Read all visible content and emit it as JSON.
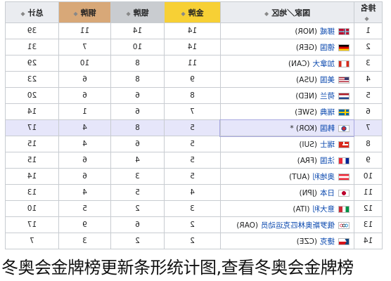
{
  "colors": {
    "header_gold": "#f7d035",
    "header_silver": "#c9ccd0",
    "header_bronze": "#d8a878",
    "header_default": "#eaecf0",
    "host_row": "#e6e6fa",
    "link": "#0645ad"
  },
  "table": {
    "headers": {
      "rank": "排名",
      "nation": "国家／地区",
      "gold": "金牌",
      "silver": "银牌",
      "bronze": "铜牌",
      "total": "总计"
    },
    "rows": [
      {
        "rank": "1",
        "flag": "flag-norway-icon",
        "name": "挪威",
        "code": "(NOR)",
        "gold": "14",
        "silver": "14",
        "bronze": "11",
        "total": "39"
      },
      {
        "rank": "2",
        "flag": "flag-germany-icon",
        "name": "德国",
        "code": "(GER)",
        "gold": "14",
        "silver": "10",
        "bronze": "7",
        "total": "31"
      },
      {
        "rank": "3",
        "flag": "flag-canada-icon",
        "name": "加拿大",
        "code": "(CAN)",
        "gold": "11",
        "silver": "8",
        "bronze": "10",
        "total": "29"
      },
      {
        "rank": "4",
        "flag": "flag-usa-icon",
        "name": "美国",
        "code": "(USA)",
        "gold": "9",
        "silver": "8",
        "bronze": "6",
        "total": "23"
      },
      {
        "rank": "5",
        "flag": "flag-netherlands-icon",
        "name": "荷兰",
        "code": "(NED)",
        "gold": "8",
        "silver": "6",
        "bronze": "6",
        "total": "20"
      },
      {
        "rank": "6",
        "flag": "flag-sweden-icon",
        "name": "瑞典",
        "code": "(SWE)",
        "gold": "7",
        "silver": "6",
        "bronze": "1",
        "total": "14"
      },
      {
        "rank": "7",
        "flag": "flag-korea-icon",
        "name": "韩国",
        "code": "(KOR) *",
        "gold": "5",
        "silver": "8",
        "bronze": "4",
        "total": "17",
        "host": true
      },
      {
        "rank": "8",
        "flag": "flag-switzerland-icon",
        "name": "瑞士",
        "code": "(SUI)",
        "gold": "5",
        "silver": "6",
        "bronze": "4",
        "total": "15"
      },
      {
        "rank": "9",
        "flag": "flag-france-icon",
        "name": "法国",
        "code": "(FRA)",
        "gold": "5",
        "silver": "4",
        "bronze": "6",
        "total": "15"
      },
      {
        "rank": "10",
        "flag": "flag-austria-icon",
        "name": "奥地利",
        "code": "(AUT)",
        "gold": "5",
        "silver": "3",
        "bronze": "6",
        "total": "14"
      },
      {
        "rank": "11",
        "flag": "flag-japan-icon",
        "name": "日本",
        "code": "(JPN)",
        "gold": "4",
        "silver": "5",
        "bronze": "4",
        "total": "13"
      },
      {
        "rank": "12",
        "flag": "flag-italy-icon",
        "name": "意大利",
        "code": "(ITA)",
        "gold": "3",
        "silver": "2",
        "bronze": "5",
        "total": "10"
      },
      {
        "rank": "13",
        "flag": "flag-olympic-icon",
        "name": "俄罗斯奥林匹克运动员",
        "code": "(OAR)",
        "gold": "2",
        "silver": "6",
        "bronze": "9",
        "total": "17"
      },
      {
        "rank": "14",
        "flag": "flag-czech-icon",
        "name": "捷克",
        "code": "(CZE)",
        "gold": "2",
        "silver": "2",
        "bronze": "3",
        "total": "7"
      }
    ]
  },
  "caption": "冬奥会金牌榜更新条形统计图,查看冬奥会金牌榜"
}
